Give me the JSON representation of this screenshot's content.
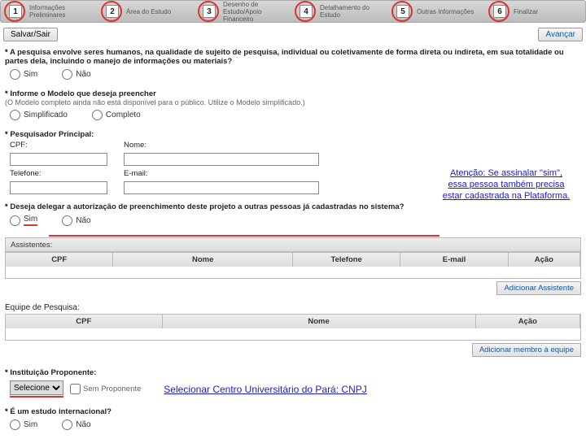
{
  "steps": [
    {
      "num": "1",
      "label": "Informações\nPreliminares"
    },
    {
      "num": "2",
      "label": "Área do Estudo"
    },
    {
      "num": "3",
      "label": "Desenho de\nEstudo/Apoio\nFinanceiro"
    },
    {
      "num": "4",
      "label": "Detalhamento do\nEstudo"
    },
    {
      "num": "5",
      "label": "Outras Informações"
    },
    {
      "num": "6",
      "label": "Finalizar"
    }
  ],
  "toolbar": {
    "save": "Salvar/Sair",
    "next": "Avançar"
  },
  "q1": {
    "text": "A pesquisa envolve seres humanos, na qualidade de sujeito de pesquisa, individual ou coletivamente de forma direta ou indireta, em sua totalidade ou partes dela, incluindo o manejo de informações ou materiais?"
  },
  "opts": {
    "sim": "Sim",
    "nao": "Não"
  },
  "q2": {
    "text": "Informe o Modelo que deseja preencher",
    "hint": "(O Modelo completo ainda não está disponível para o público. Utilize o Modelo simplificado.)"
  },
  "model": {
    "simpl": "Simplificado",
    "compl": "Completo"
  },
  "pp": {
    "title": "Pesquisador Principal:",
    "cpf": "CPF:",
    "nome": "Nome:",
    "tel": "Telefone:",
    "email": "E-mail:"
  },
  "q3": {
    "text": "Deseja delegar a autorização de preenchimento deste projeto a outras pessoas já cadastradas no sistema?"
  },
  "assist": {
    "title": "Assistentes:",
    "cols": [
      "CPF",
      "Nome",
      "Telefone",
      "E-mail",
      "Ação"
    ],
    "add": "Adicionar Assistente"
  },
  "equipe": {
    "title": "Equipe de Pesquisa:",
    "cols": [
      "CPF",
      "Nome",
      "Ação"
    ],
    "add": "Adicionar membro à equipe"
  },
  "inst": {
    "label": "Instituição Proponente:",
    "sel": "Selecione",
    "chk": "Sem Proponente"
  },
  "q4": {
    "text": "É um estudo internacional?"
  },
  "callout": "Atenção: Se assinalar \"sim\", essa pessoa também precisa estar cadastrada na Plataforma.",
  "annotation": "Selecionar Centro Universitário do Pará: CNPJ"
}
